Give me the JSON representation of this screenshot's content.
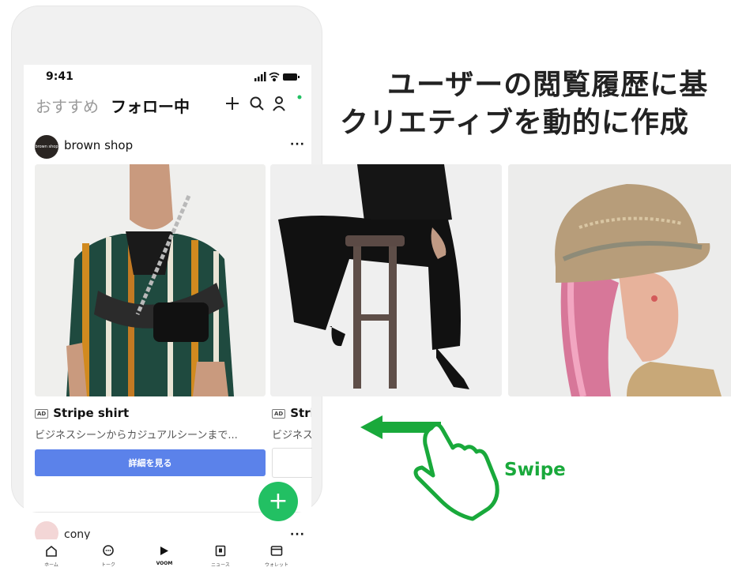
{
  "status_bar": {
    "time": "9:41"
  },
  "header": {
    "tab_recommended": "おすすめ",
    "tab_following": "フォロー中"
  },
  "post": {
    "shop_avatar_text": "brown shop",
    "shop_name": "brown shop",
    "more_label": "···",
    "ad_badge": "AD",
    "product_title": "Stripe shirt",
    "product_desc": "ビジネスシーンからカジュアルシーンまで...",
    "next_title": "Stri",
    "next_desc": "ビジネス",
    "detail_button": "詳細を見る"
  },
  "next_post": {
    "user_name": "cony",
    "more_label": "···"
  },
  "fab": {
    "label": "+"
  },
  "nav": {
    "items": [
      {
        "label": "ホーム",
        "icon": "home-icon"
      },
      {
        "label": "トーク",
        "icon": "chat-icon"
      },
      {
        "label": "VOOM",
        "icon": "voom-icon"
      },
      {
        "label": "ニュース",
        "icon": "news-icon"
      },
      {
        "label": "ウォレット",
        "icon": "wallet-icon"
      }
    ]
  },
  "headline": {
    "line1": "ユーザーの閲覧履歴に基",
    "line2": "クリエティブを動的に作成"
  },
  "gesture": {
    "label": "Swipe"
  },
  "colors": {
    "accent_green": "#19a93b",
    "button_blue": "#5b82ea",
    "fab_green": "#22c063"
  }
}
